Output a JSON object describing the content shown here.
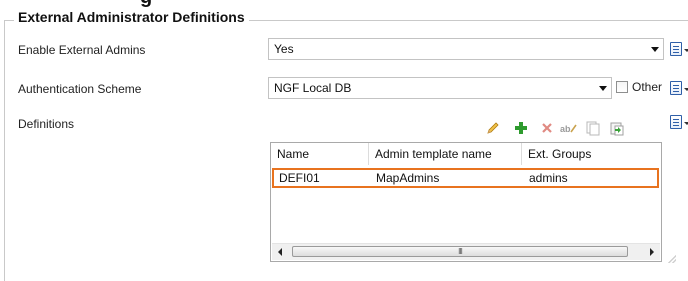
{
  "group": {
    "title": "External Administrator Definitions"
  },
  "fields": {
    "enable_external_admins": {
      "label": "Enable External Admins",
      "value": "Yes"
    },
    "authentication_scheme": {
      "label": "Authentication Scheme",
      "value": "NGF Local DB",
      "other_label": "Other"
    },
    "definitions": {
      "label": "Definitions"
    }
  },
  "toolbar": [
    "edit-icon",
    "add-icon",
    "delete-icon",
    "rename-icon",
    "copy-icon",
    "paste-icon"
  ],
  "table": {
    "columns": [
      "Name",
      "Admin template name",
      "Ext. Groups"
    ],
    "rows": [
      {
        "name": "DEFI01",
        "template": "MapAdmins",
        "groups": "admins"
      }
    ],
    "scrollbar_grip": "III"
  },
  "colors": {
    "selection_border": "#e8731f",
    "add_green": "#2e9b2e",
    "delete_red": "#d9362a"
  }
}
